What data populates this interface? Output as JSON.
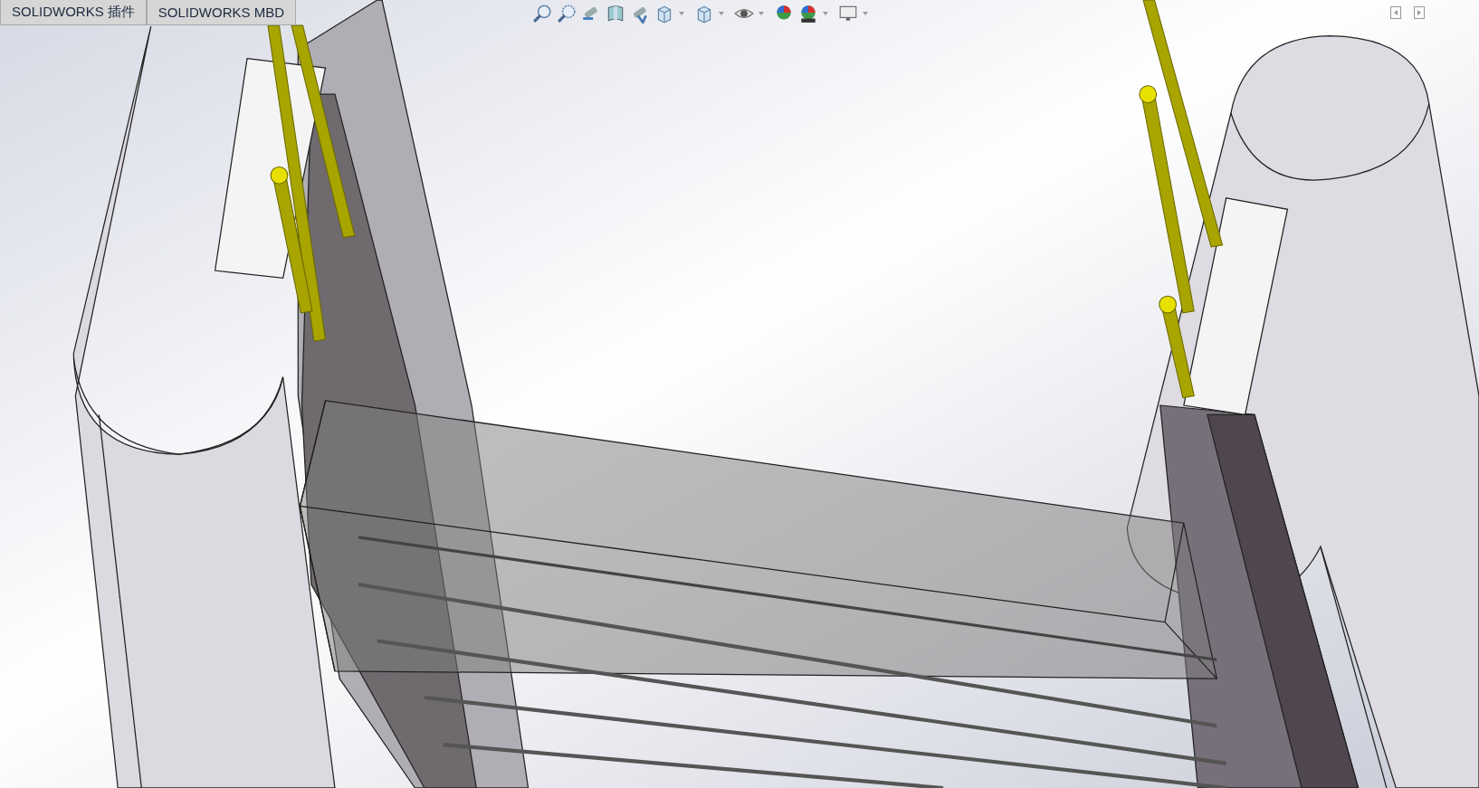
{
  "tabs": [
    {
      "label": "SOLIDWORKS 插件",
      "selected": false
    },
    {
      "label": "SOLIDWORKS MBD",
      "selected": false
    }
  ]
}
